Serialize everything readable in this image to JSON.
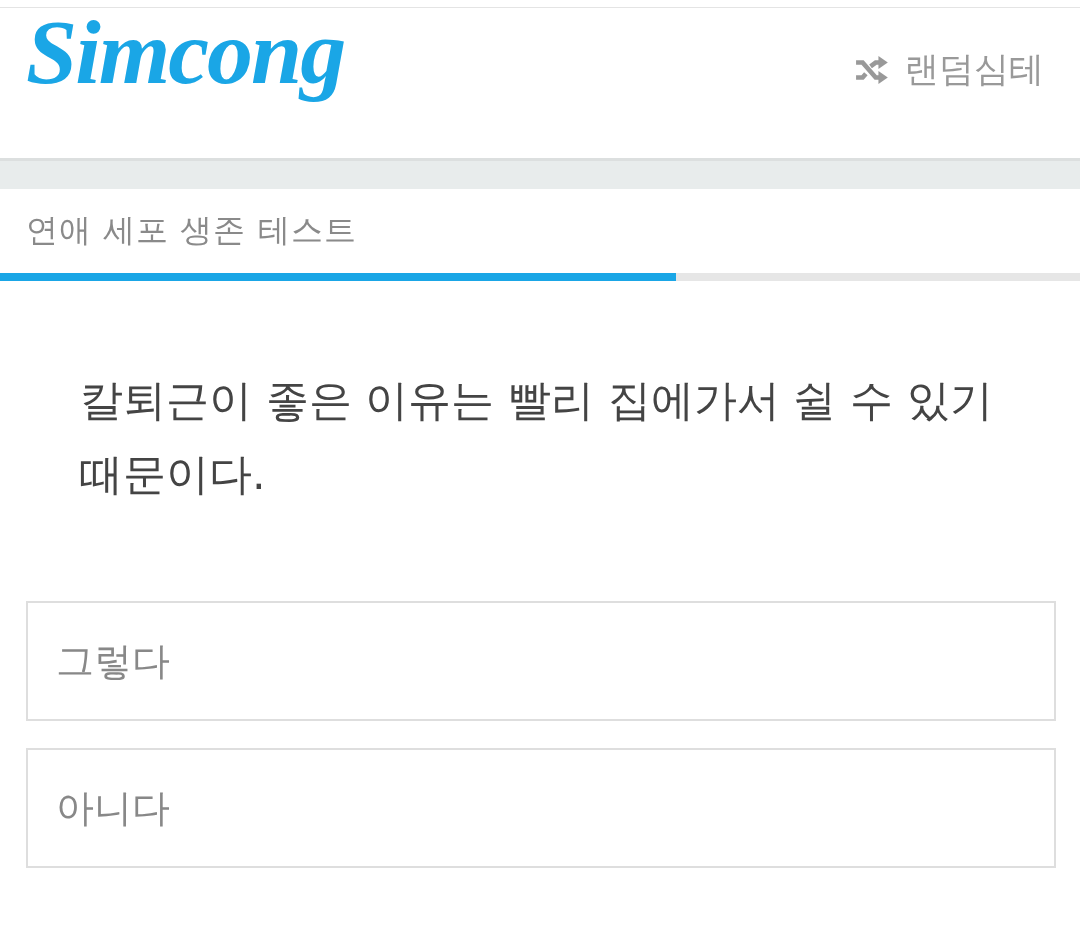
{
  "header": {
    "logo": "Simcong",
    "random_button": {
      "label": "랜덤심테"
    }
  },
  "test": {
    "title": "연애 세포 생존 테스트",
    "progress": {
      "level": 0.626
    }
  },
  "question": {
    "text": "칼퇴근이 좋은 이유는 빨리 집에가서 쉴 수 있기 때문이다."
  },
  "options": [
    {
      "label": "그렇다"
    },
    {
      "label": "아니다"
    }
  ]
}
